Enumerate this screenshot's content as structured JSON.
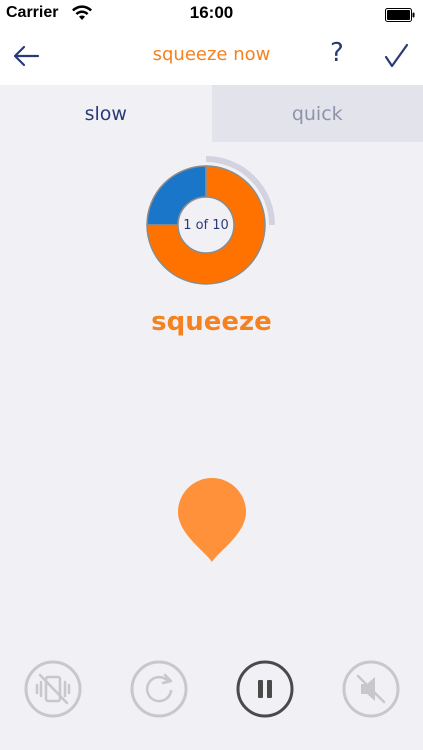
{
  "status_bar": {
    "carrier": "Carrier",
    "time": "16:00"
  },
  "nav": {
    "title": "squeeze now",
    "help_label": "?",
    "back_icon": "arrow-left-icon",
    "done_icon": "checkmark-icon"
  },
  "tabs": [
    {
      "label": "slow",
      "active": true
    },
    {
      "label": "quick",
      "active": false
    }
  ],
  "progress": {
    "counter_text": "1 of 10",
    "current": 1,
    "total": 10,
    "squeeze_fraction": 0.75,
    "rest_fraction": 0.25
  },
  "exercise": {
    "word": "squeeze"
  },
  "controls": [
    {
      "name": "vibration-off-button",
      "icon": "vibration-off-icon",
      "active": false
    },
    {
      "name": "restart-button",
      "icon": "restart-icon",
      "active": false
    },
    {
      "name": "pause-button",
      "icon": "pause-icon",
      "active": true
    },
    {
      "name": "mute-button",
      "icon": "speaker-muted-icon",
      "active": false
    }
  ],
  "colors": {
    "accent_orange": "#f58220",
    "segment_blue": "#1a76c9",
    "navy": "#2a3a78",
    "drop_orange": "#ff913a",
    "control_gray": "#c8c8cc",
    "control_active": "#4a4a4a"
  }
}
